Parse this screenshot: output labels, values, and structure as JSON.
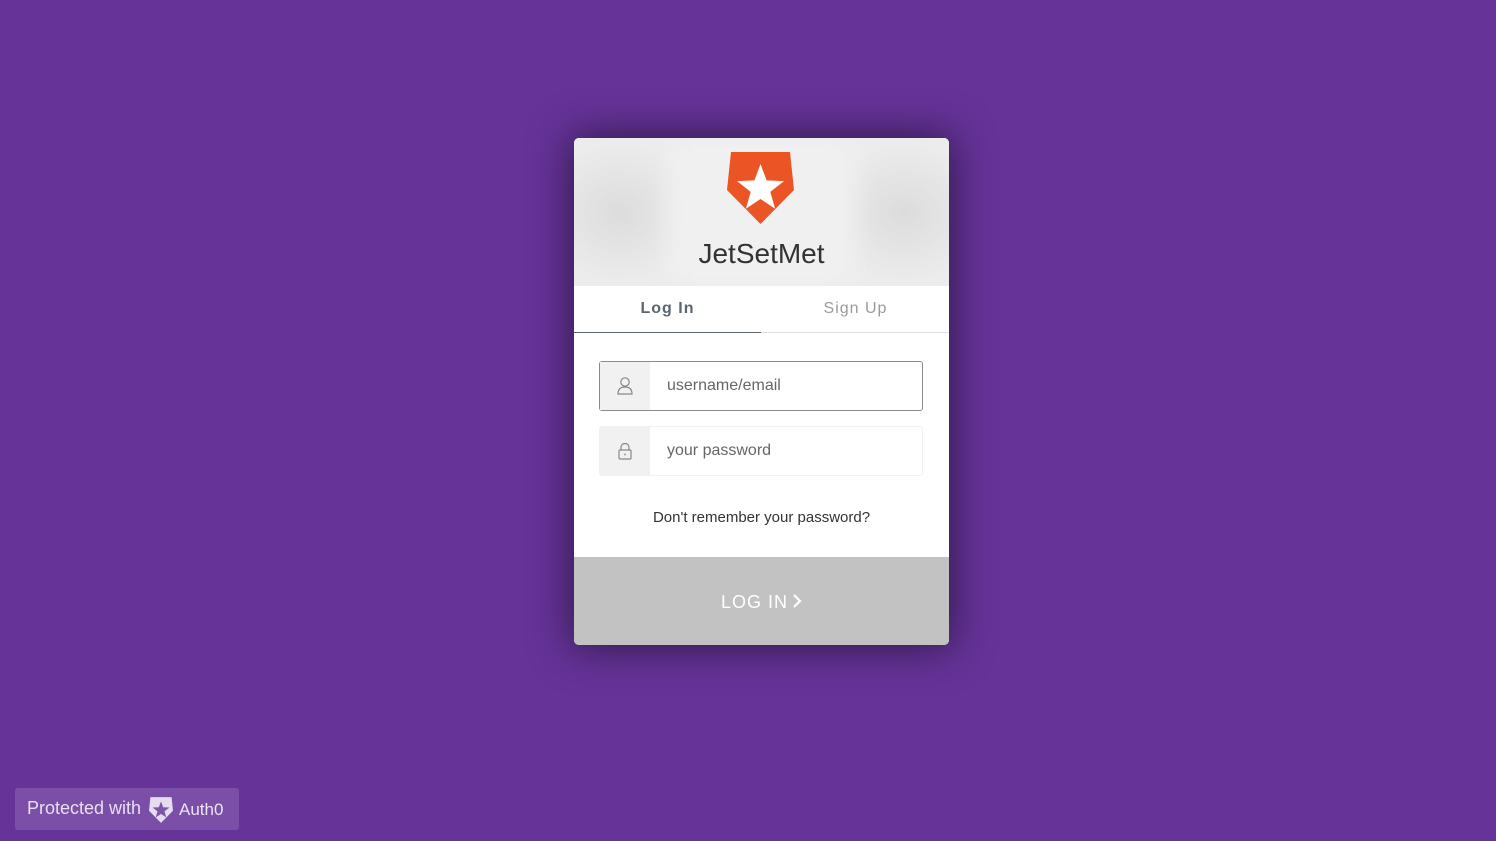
{
  "app": {
    "title": "JetSetMet",
    "logo_icon": "auth0-shield-star-icon",
    "logo_color": "#eb5424"
  },
  "tabs": [
    {
      "label": "Log In",
      "active": true
    },
    {
      "label": "Sign Up",
      "active": false
    }
  ],
  "form": {
    "username_placeholder": "username/email",
    "username_value": "",
    "username_icon": "user-icon",
    "password_placeholder": "your password",
    "password_value": "",
    "password_icon": "lock-icon",
    "forgot_label": "Don't remember your password?",
    "submit_label": "LOG IN",
    "submit_icon": "chevron-right-icon"
  },
  "footer": {
    "protected_label": "Protected with",
    "brand_label": "Auth0",
    "brand_icon": "auth0-badge-icon"
  },
  "colors": {
    "background": "#663399",
    "submit_disabled": "#c2c2c2",
    "accent": "#eb5424"
  }
}
